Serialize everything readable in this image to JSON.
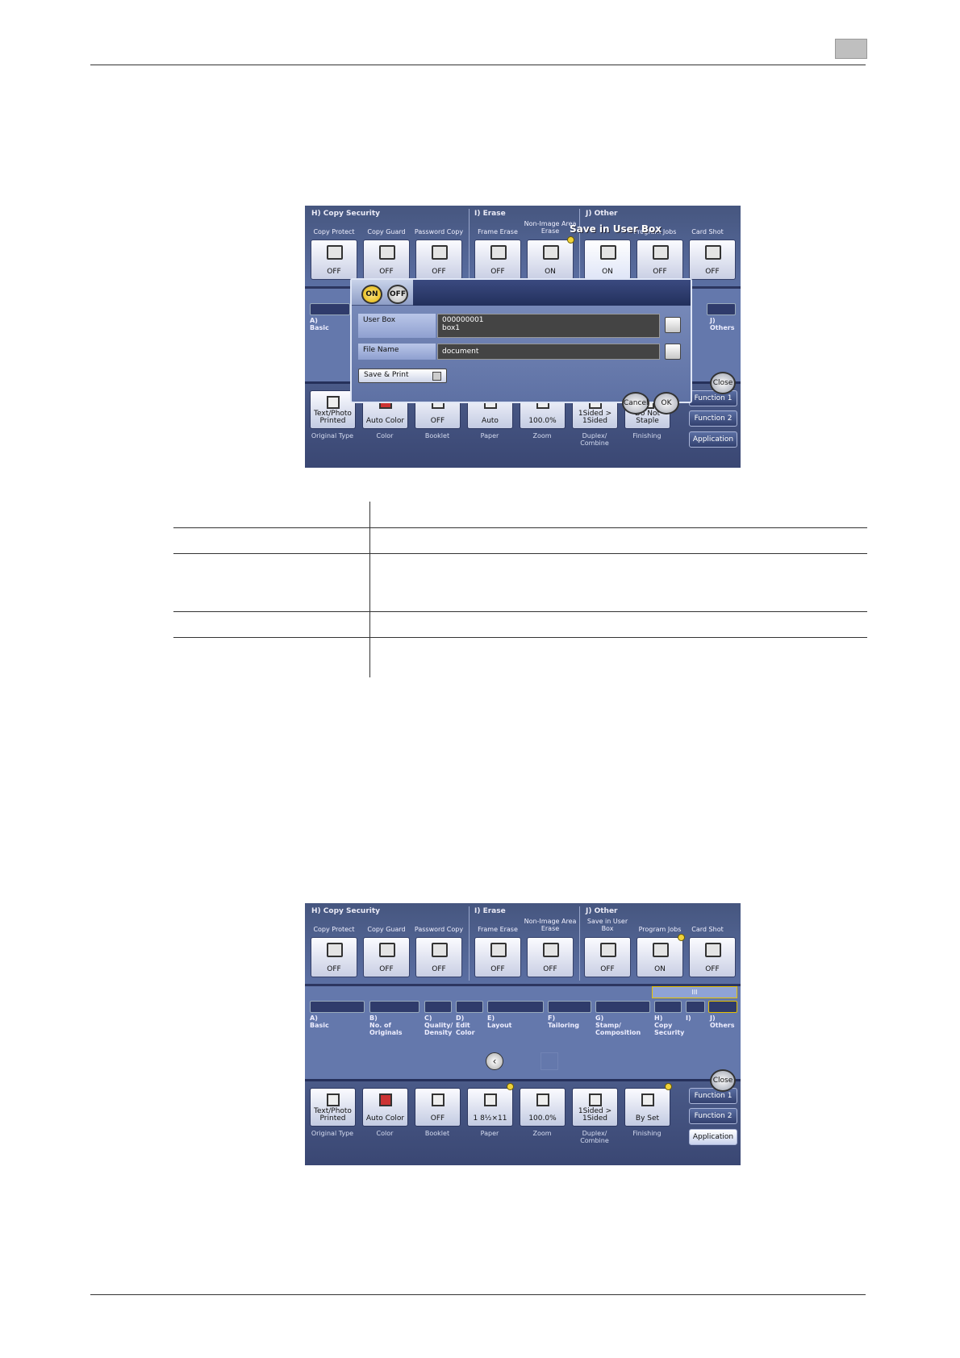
{
  "shot1": {
    "groups": {
      "h": "H)   Copy Security",
      "i": "I)   Erase",
      "j": "J)   Other"
    },
    "functions": [
      {
        "label": "Copy Protect",
        "value": "OFF"
      },
      {
        "label": "Copy Guard",
        "value": "OFF"
      },
      {
        "label": "Password Copy",
        "value": "OFF"
      },
      {
        "label": "Frame Erase",
        "value": "OFF"
      },
      {
        "label": "Non-Image Area Erase",
        "value": "ON"
      },
      {
        "label": "Save in User Box",
        "value": "ON"
      },
      {
        "label": "Program Jobs",
        "value": "OFF"
      },
      {
        "label": "Card Shot",
        "value": "OFF"
      }
    ],
    "dialog": {
      "title": "Save in User Box",
      "on_label": "ON",
      "off_label": "OFF",
      "user_box_label": "User Box",
      "user_box_number": "000000001",
      "user_box_name": "box1",
      "file_name_label": "File Name",
      "file_name_value": "document",
      "save_print_label": "Save & Print",
      "cancel": "Cancel",
      "ok": "OK"
    },
    "mid_left": {
      "code": "A)",
      "name": "Basic"
    },
    "mid_right": {
      "code": "J)",
      "name": "Others"
    }
  },
  "shot2": {
    "groups": {
      "h": "H)   Copy Security",
      "i": "I)   Erase",
      "j": "J)   Other"
    },
    "functions": [
      {
        "label": "Copy Protect",
        "value": "OFF"
      },
      {
        "label": "Copy Guard",
        "value": "OFF"
      },
      {
        "label": "Password Copy",
        "value": "OFF"
      },
      {
        "label": "Frame Erase",
        "value": "OFF"
      },
      {
        "label": "Non-Image Area Erase",
        "value": "OFF"
      },
      {
        "label": "Save in User Box",
        "value": "OFF"
      },
      {
        "label": "Program Jobs",
        "value": "ON"
      },
      {
        "label": "Card Shot",
        "value": "OFF"
      }
    ],
    "tabs": [
      {
        "code": "A)",
        "name": "Basic"
      },
      {
        "code": "B)",
        "name": "No. of Originals"
      },
      {
        "code": "C)",
        "name": "Quality/ Density"
      },
      {
        "code": "D)",
        "name": "Edit Color"
      },
      {
        "code": "E)",
        "name": "Layout"
      },
      {
        "code": "F)",
        "name": "Tailoring"
      },
      {
        "code": "G)",
        "name": "Stamp/ Composition"
      },
      {
        "code": "H)",
        "name": "Copy Security"
      },
      {
        "code": "I)",
        "name": ""
      },
      {
        "code": "J)",
        "name": "Others"
      }
    ],
    "scroll_indicator": "III"
  },
  "bottom1": [
    {
      "value": "Text/Photo Printed",
      "label": "Original Type"
    },
    {
      "value": "Auto Color",
      "label": "Color"
    },
    {
      "value": "OFF",
      "label": "Booklet"
    },
    {
      "value": "Auto",
      "label": "Paper"
    },
    {
      "value": "100.0%",
      "label": "Zoom"
    },
    {
      "value": "1Sided > 1Sided",
      "label": "Duplex/ Combine"
    },
    {
      "value": "Do Not Staple",
      "label": "Finishing"
    }
  ],
  "bottom2": [
    {
      "value": "Text/Photo Printed",
      "label": "Original Type"
    },
    {
      "value": "Auto Color",
      "label": "Color"
    },
    {
      "value": "OFF",
      "label": "Booklet"
    },
    {
      "value": "1 8½×11",
      "label": "Paper"
    },
    {
      "value": "100.0%",
      "label": "Zoom"
    },
    {
      "value": "1Sided > 1Sided",
      "label": "Duplex/ Combine"
    },
    {
      "value": "By Set",
      "label": "Finishing"
    }
  ],
  "side": {
    "close": "Close",
    "function1": "Function 1",
    "function2": "Function 2",
    "application": "Application"
  }
}
